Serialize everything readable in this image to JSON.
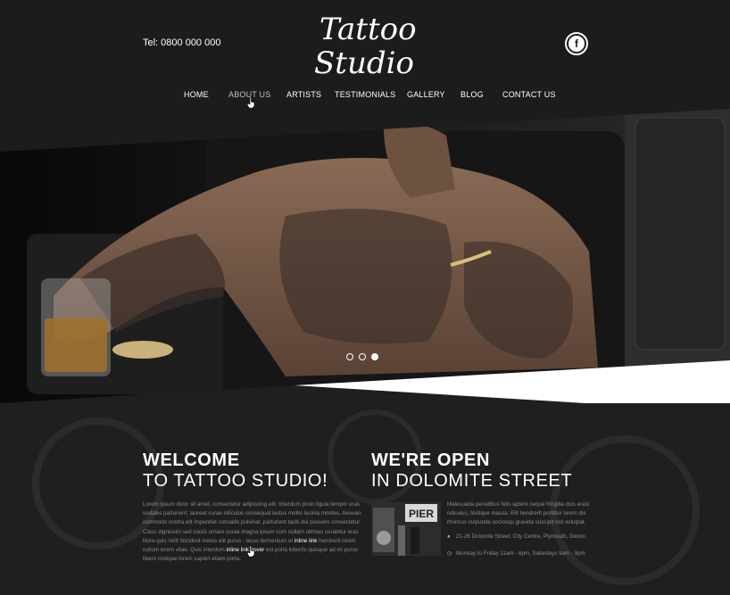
{
  "header": {
    "tel": "Tel: 0800 000 000",
    "logo_line1": "Tattoo",
    "logo_line2": "Studio",
    "social_icon": "facebook-icon",
    "social_glyph": "f"
  },
  "nav": {
    "items": [
      {
        "label": "HOME"
      },
      {
        "label": "ABOUT US",
        "active": true
      },
      {
        "label": "ARTISTS"
      },
      {
        "label": "TESTIMONIALS"
      },
      {
        "label": "GALLERY"
      },
      {
        "label": "BLOG"
      },
      {
        "label": "CONTACT US"
      }
    ]
  },
  "slider": {
    "total_slides": 3,
    "active_slide": 3
  },
  "welcome": {
    "title_bold": "WELCOME",
    "title_light": "TO TATTOO STUDIO!",
    "text_part1": "Lorem ipsum dolor sit amet, consectetur adipiscing elit. Interdum proin ligula tempor eras sodales parturient; laoreet curae ridiculus consequat lectus mollis lacinia montes. Aenean commodo nostra elit imperdiet convallis pulvinar, parturient taciti dui posuere consectetur. Class dignissim sed cociis ornare curae magna ipsum cum nullam ultrices curabitur eras litora quis Velit tincidunt metus elit purus - lacus fermentum et",
    "link1": "inline link",
    "text_part2": "hendrerit lorem rutrum lorem vitae. Quis interdum",
    "link2": "inline link hover",
    "text_part3": "est porta lobortis quisque ad mi purus libero tristique lorem sapien etiam porta."
  },
  "open": {
    "title_bold": "WE'RE OPEN",
    "title_light": "IN DOLOMITE STREET",
    "text": "Malesuada penatibus felis aptent neque fringilla duis erast ridiculus, tristique massa. Elit hendrerit porttitor lorem dis rhoncus vulputate sociosqu gravida suscipit nisl volutpat.",
    "address": "21-26 Dolomite Street, City Centre, Plymouth, Devon",
    "hours": "Monday to Friday 11am - 6pm,  Saturdays 9am - 9pm",
    "address_icon": "map-pin-icon",
    "hours_icon": "clock-icon",
    "image_sign": "PIER"
  },
  "colors": {
    "background": "#1b1b1b",
    "text": "#ffffff",
    "muted": "#8a8a8a"
  }
}
